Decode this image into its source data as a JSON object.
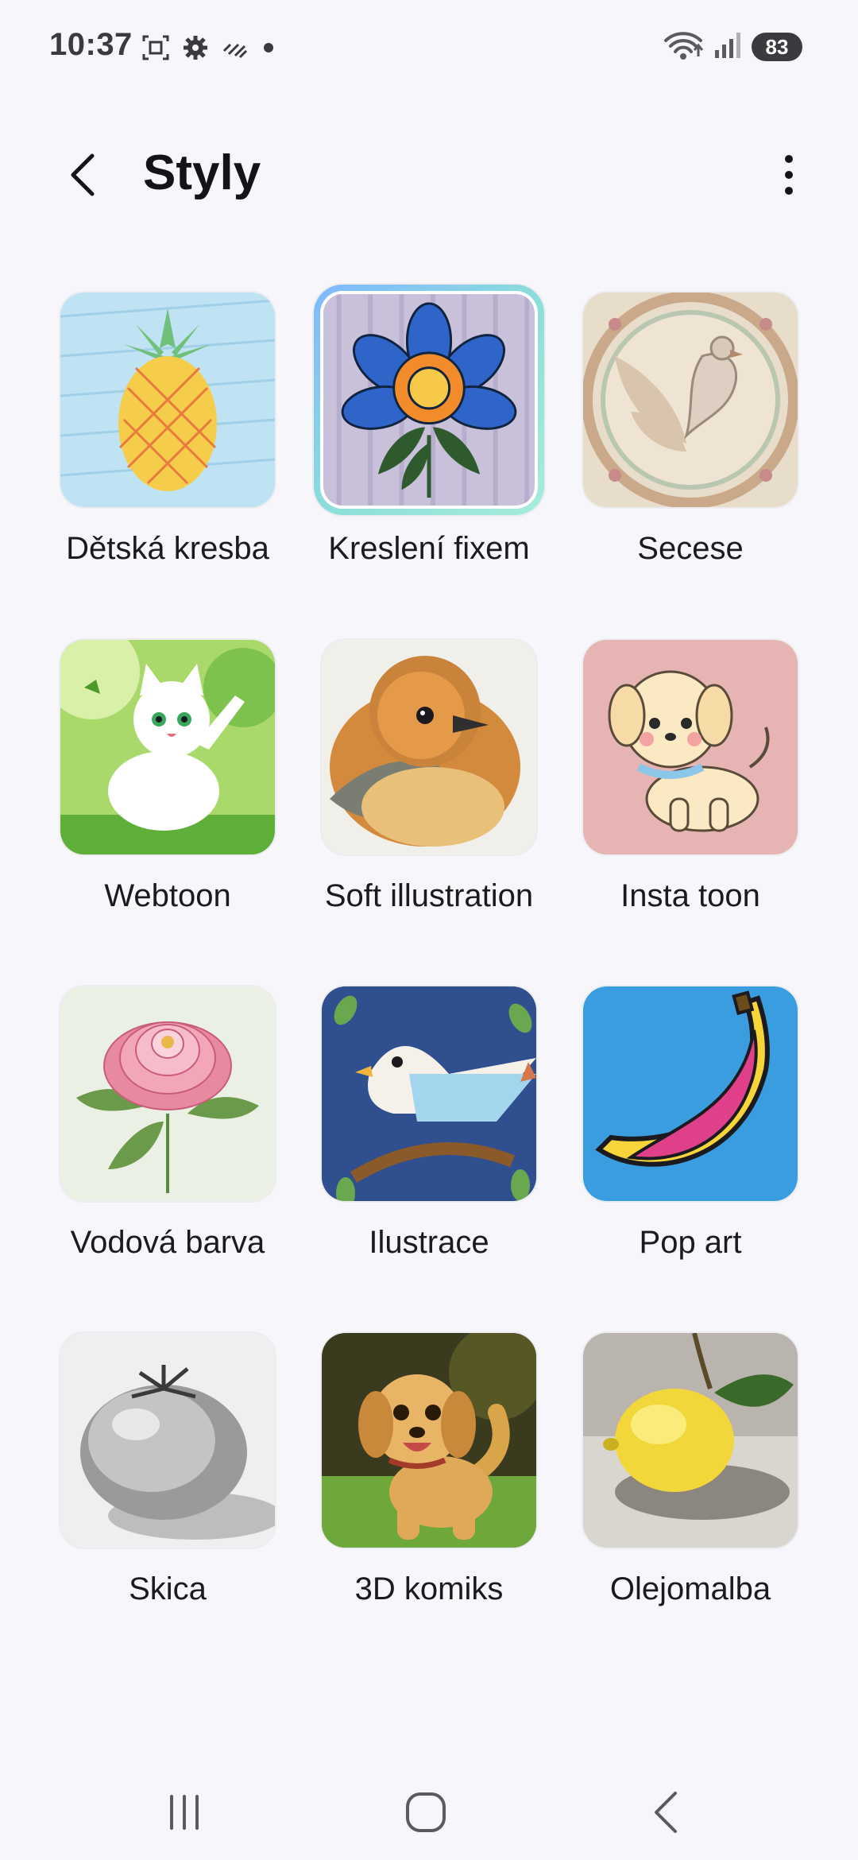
{
  "status_bar": {
    "time": "10:37",
    "battery": "83",
    "left_icons": [
      "screenshot-icon",
      "settings-gear-icon",
      "sync-icon",
      "dot-icon"
    ],
    "right_icons": [
      "wifi-icon",
      "signal-icon",
      "battery-icon"
    ]
  },
  "header": {
    "title": "Styly",
    "back_icon": "back-arrow-icon",
    "more_icon": "more-vert-icon"
  },
  "styles": [
    {
      "label": "Dětská kresba",
      "selected": false
    },
    {
      "label": "Kreslení fixem",
      "selected": true
    },
    {
      "label": "Secese",
      "selected": false
    },
    {
      "label": "Webtoon",
      "selected": false
    },
    {
      "label": "Soft illustration",
      "selected": false
    },
    {
      "label": "Insta toon",
      "selected": false
    },
    {
      "label": "Vodová barva",
      "selected": false
    },
    {
      "label": "Ilustrace",
      "selected": false
    },
    {
      "label": "Pop art",
      "selected": false
    },
    {
      "label": "Skica",
      "selected": false
    },
    {
      "label": "3D komiks",
      "selected": false
    },
    {
      "label": "Olejomalba",
      "selected": false
    }
  ],
  "nav_bar": {
    "recents_icon": "recents-icon",
    "home_icon": "home-icon",
    "back_icon": "nav-back-icon"
  },
  "colors": {
    "background": "#f7f6fb",
    "selection_ring": "#8de0d8",
    "text": "#1b1b1f"
  }
}
